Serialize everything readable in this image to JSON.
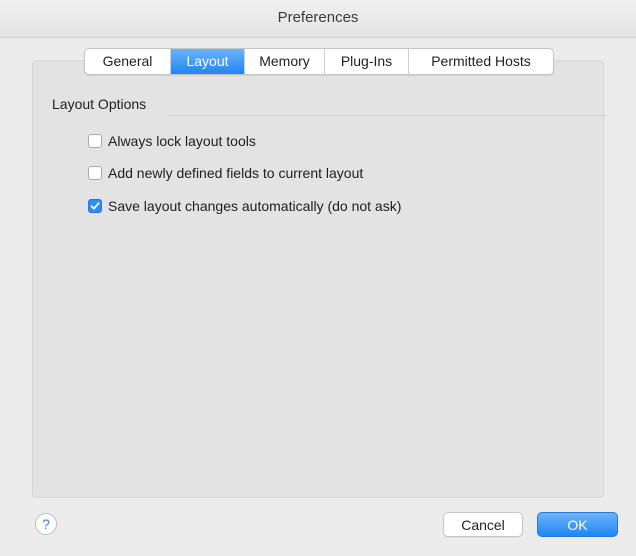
{
  "window": {
    "title": "Preferences"
  },
  "tabs": [
    {
      "label": "General",
      "active": false
    },
    {
      "label": "Layout",
      "active": true
    },
    {
      "label": "Memory",
      "active": false
    },
    {
      "label": "Plug-Ins",
      "active": false
    },
    {
      "label": "Permitted Hosts",
      "active": false
    }
  ],
  "layout_options": {
    "section_title": "Layout Options",
    "options": [
      {
        "label": "Always lock layout tools",
        "checked": false
      },
      {
        "label": "Add newly defined fields to current layout",
        "checked": false
      },
      {
        "label": "Save layout changes automatically (do not ask)",
        "checked": true
      }
    ]
  },
  "footer": {
    "help_glyph": "?",
    "cancel_label": "Cancel",
    "ok_label": "OK"
  },
  "icons": {
    "help": "help-icon",
    "checkmark": "checkmark-icon"
  },
  "colors": {
    "accent": "#1f86f2",
    "window_bg": "#ececec",
    "panel_bg": "#e3e3e3"
  }
}
